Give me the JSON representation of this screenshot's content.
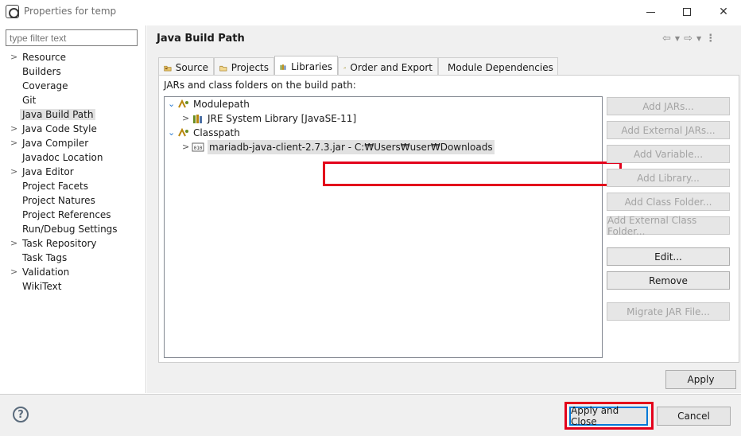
{
  "window": {
    "title": "Properties for temp",
    "minimize_icon": "minimize-icon",
    "maximize_icon": "maximize-icon",
    "close_glyph": "✕"
  },
  "filter": {
    "placeholder": "type filter text"
  },
  "sidebar": {
    "items": [
      {
        "label": "Resource",
        "expandable": true
      },
      {
        "label": "Builders",
        "expandable": false
      },
      {
        "label": "Coverage",
        "expandable": false
      },
      {
        "label": "Git",
        "expandable": false
      },
      {
        "label": "Java Build Path",
        "expandable": false,
        "selected": true
      },
      {
        "label": "Java Code Style",
        "expandable": true
      },
      {
        "label": "Java Compiler",
        "expandable": true
      },
      {
        "label": "Javadoc Location",
        "expandable": false
      },
      {
        "label": "Java Editor",
        "expandable": true
      },
      {
        "label": "Project Facets",
        "expandable": false
      },
      {
        "label": "Project Natures",
        "expandable": false
      },
      {
        "label": "Project References",
        "expandable": false
      },
      {
        "label": "Run/Debug Settings",
        "expandable": false
      },
      {
        "label": "Task Repository",
        "expandable": true
      },
      {
        "label": "Task Tags",
        "expandable": false
      },
      {
        "label": "Validation",
        "expandable": true
      },
      {
        "label": "WikiText",
        "expandable": false
      }
    ]
  },
  "page": {
    "title": "Java Build Path",
    "tabs": [
      {
        "label": "Source",
        "icon": "source-folder-icon"
      },
      {
        "label": "Projects",
        "icon": "projects-folder-icon"
      },
      {
        "label": "Libraries",
        "icon": "libraries-icon",
        "active": true
      },
      {
        "label": "Order and Export",
        "icon": "order-export-icon"
      },
      {
        "label": "Module Dependencies",
        "icon": "module-icon"
      }
    ],
    "caption": "JARs and class folders on the build path:",
    "tree": {
      "modulepath": "Modulepath",
      "jre": "JRE System Library [JavaSE-11]",
      "classpath": "Classpath",
      "jar": "mariadb-java-client-2.7.3.jar - C:₩Users₩user₩Downloads"
    },
    "buttons": {
      "add_jars": "Add JARs...",
      "add_external_jars": "Add External JARs...",
      "add_variable": "Add Variable...",
      "add_library": "Add Library...",
      "add_class_folder": "Add Class Folder...",
      "add_external_class_folder": "Add External Class Folder...",
      "edit": "Edit...",
      "remove": "Remove",
      "migrate_jar": "Migrate JAR File..."
    },
    "apply": "Apply"
  },
  "footer": {
    "help": "?",
    "apply_and_close": "Apply and Close",
    "cancel": "Cancel"
  },
  "colors": {
    "highlight": "#e3001b",
    "focus": "#0078d7"
  }
}
